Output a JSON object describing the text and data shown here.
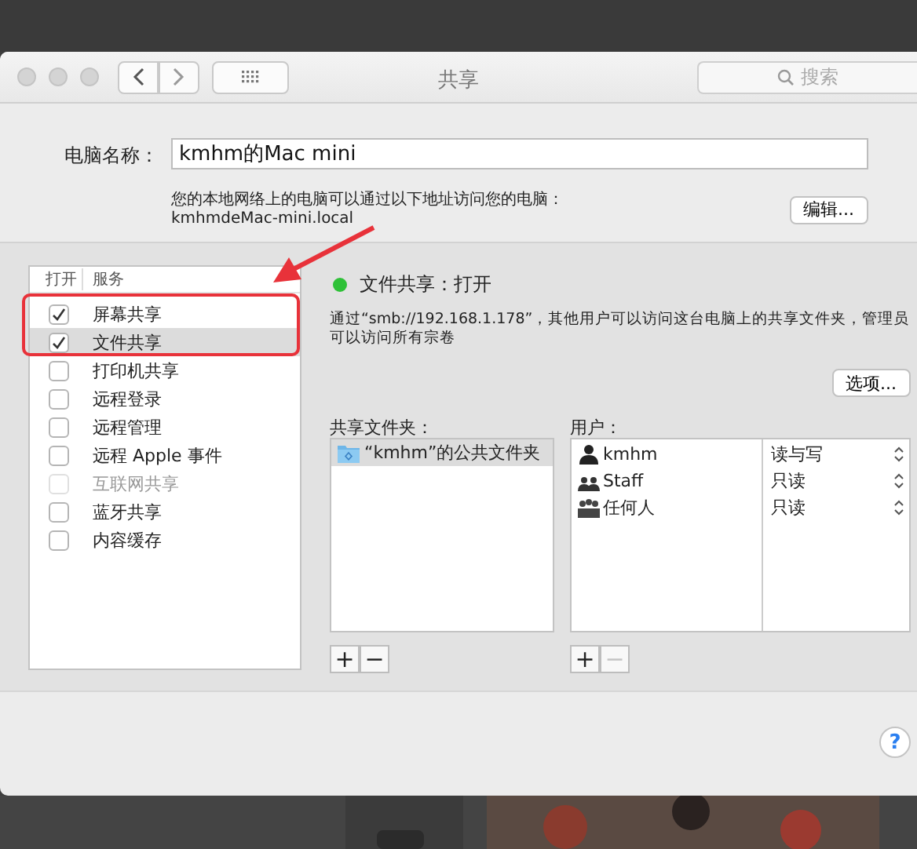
{
  "window": {
    "title": "共享"
  },
  "search": {
    "placeholder": "搜索"
  },
  "computer_name": {
    "label": "电脑名称：",
    "value": "kmhm的Mac mini",
    "hint": "您的本地网络上的电脑可以通过以下地址访问您的电脑：",
    "address": "kmhmdeMac-mini.local",
    "edit_button": "编辑..."
  },
  "services": {
    "columns": [
      "打开",
      "服务"
    ],
    "items": [
      {
        "label": "屏幕共享",
        "checked": true,
        "selected": false,
        "disabled": false
      },
      {
        "label": "文件共享",
        "checked": true,
        "selected": true,
        "disabled": false
      },
      {
        "label": "打印机共享",
        "checked": false,
        "selected": false,
        "disabled": false
      },
      {
        "label": "远程登录",
        "checked": false,
        "selected": false,
        "disabled": false
      },
      {
        "label": "远程管理",
        "checked": false,
        "selected": false,
        "disabled": false
      },
      {
        "label": "远程 Apple 事件",
        "checked": false,
        "selected": false,
        "disabled": false
      },
      {
        "label": "互联网共享",
        "checked": false,
        "selected": false,
        "disabled": true
      },
      {
        "label": "蓝牙共享",
        "checked": false,
        "selected": false,
        "disabled": false
      },
      {
        "label": "内容缓存",
        "checked": false,
        "selected": false,
        "disabled": false
      }
    ]
  },
  "status": {
    "label": "文件共享：打开",
    "on": true
  },
  "description": "通过“smb://192.168.1.178”，其他用户可以访问这台电脑上的共享文件夹，管理员可以访问所有宗卷",
  "options_button": "选项...",
  "shared_folders": {
    "label": "共享文件夹：",
    "items": [
      {
        "name": "“kmhm”的公共文件夹",
        "selected": true
      }
    ],
    "buttons": [
      {
        "label": "+",
        "disabled": false
      },
      {
        "label": "−",
        "disabled": false
      }
    ]
  },
  "users": {
    "label": "用户：",
    "items": [
      {
        "name": "kmhm",
        "kind": "user",
        "permission": "读与写"
      },
      {
        "name": "Staff",
        "kind": "group",
        "permission": "只读"
      },
      {
        "name": "任何人",
        "kind": "everyone",
        "permission": "只读"
      }
    ],
    "buttons": [
      {
        "label": "+",
        "disabled": false
      },
      {
        "label": "−",
        "disabled": true
      }
    ]
  },
  "help_button": "?"
}
